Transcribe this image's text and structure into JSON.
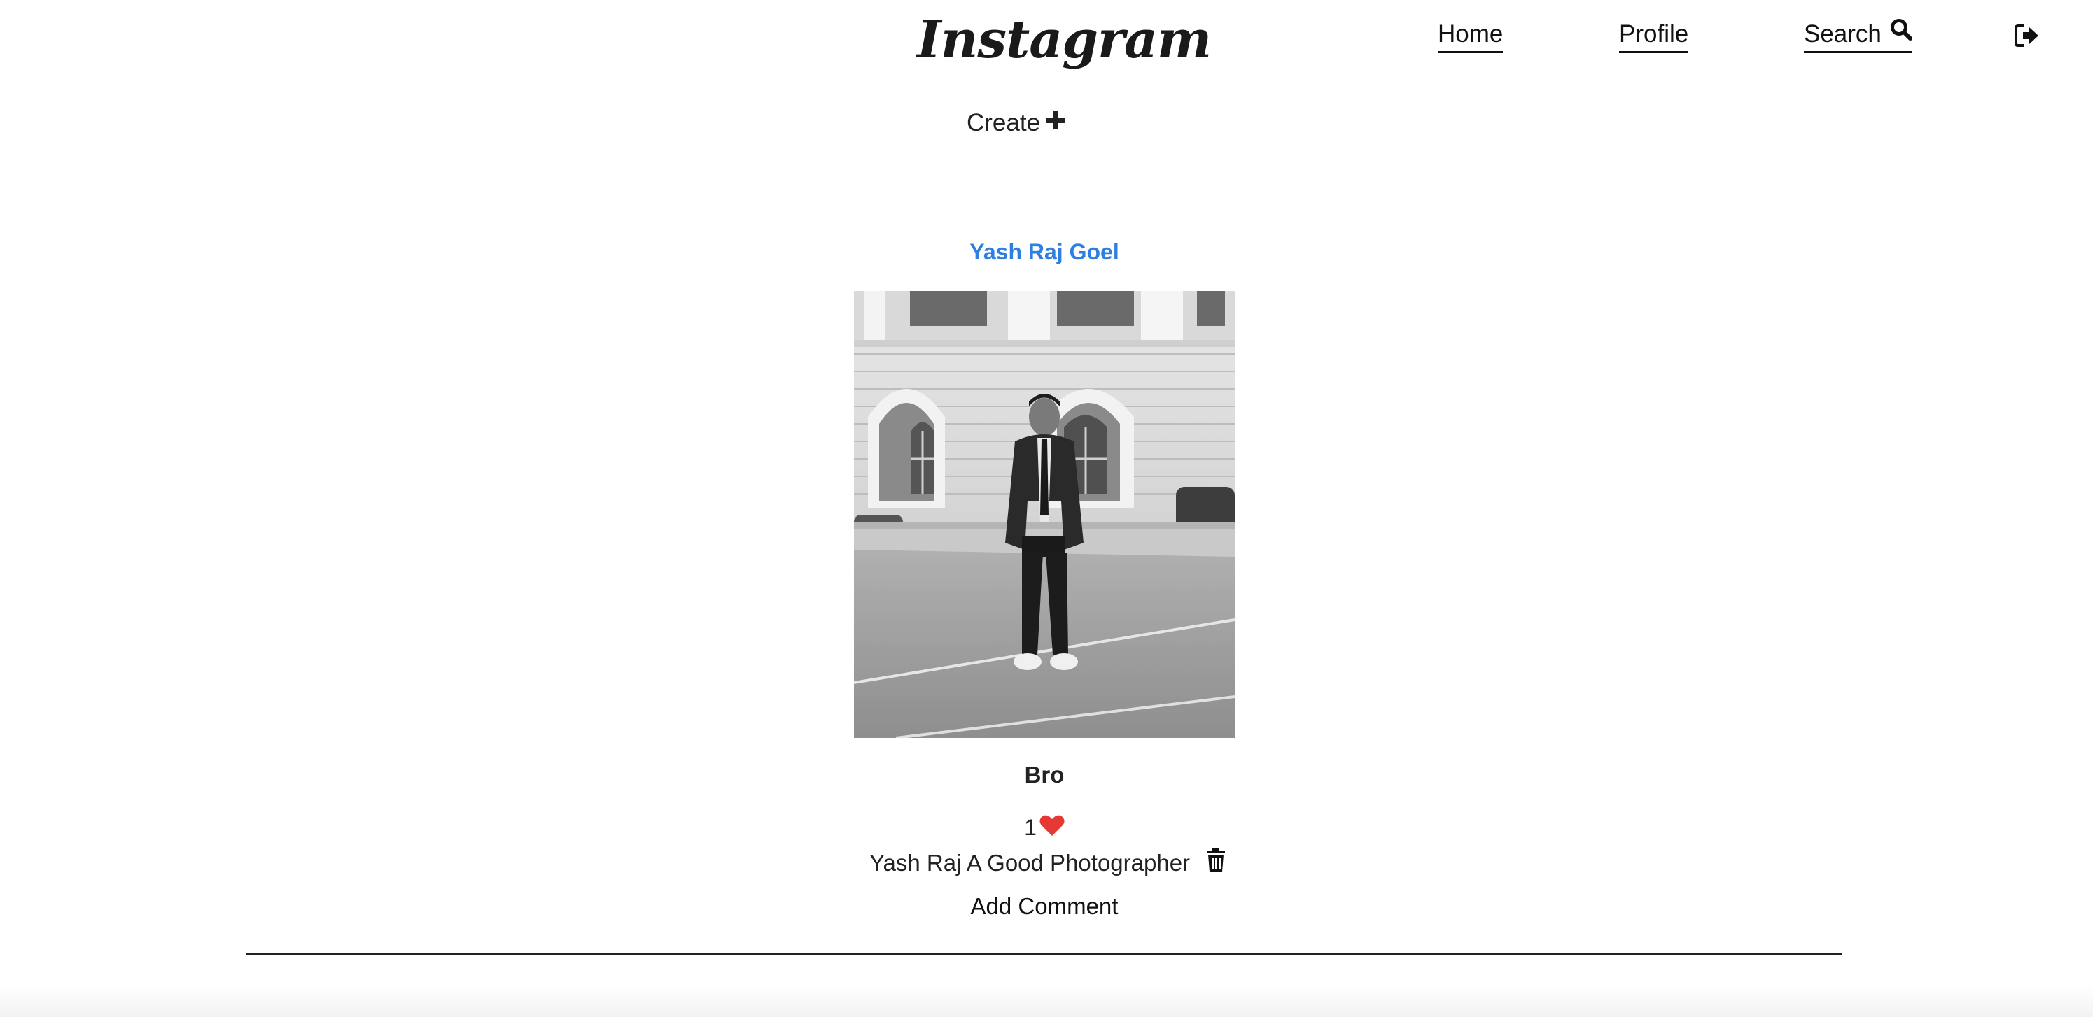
{
  "header": {
    "logo_text": "Instagram",
    "nav": {
      "home": "Home",
      "profile": "Profile",
      "search": "Search"
    },
    "icons": {
      "search": "search-icon",
      "logout": "logout-icon"
    }
  },
  "create": {
    "label": "Create",
    "icon": "plus-icon"
  },
  "post": {
    "author": "Yash Raj Goel",
    "caption": "Bro",
    "likes_count": "1",
    "like_icon": "heart-icon",
    "comments": [
      {
        "text": "Yash Raj A Good Photographer",
        "delete_icon": "trash-icon"
      }
    ],
    "add_comment_label": "Add Comment",
    "colors": {
      "author": "#2f7fe0",
      "heart": "#e53935"
    }
  }
}
